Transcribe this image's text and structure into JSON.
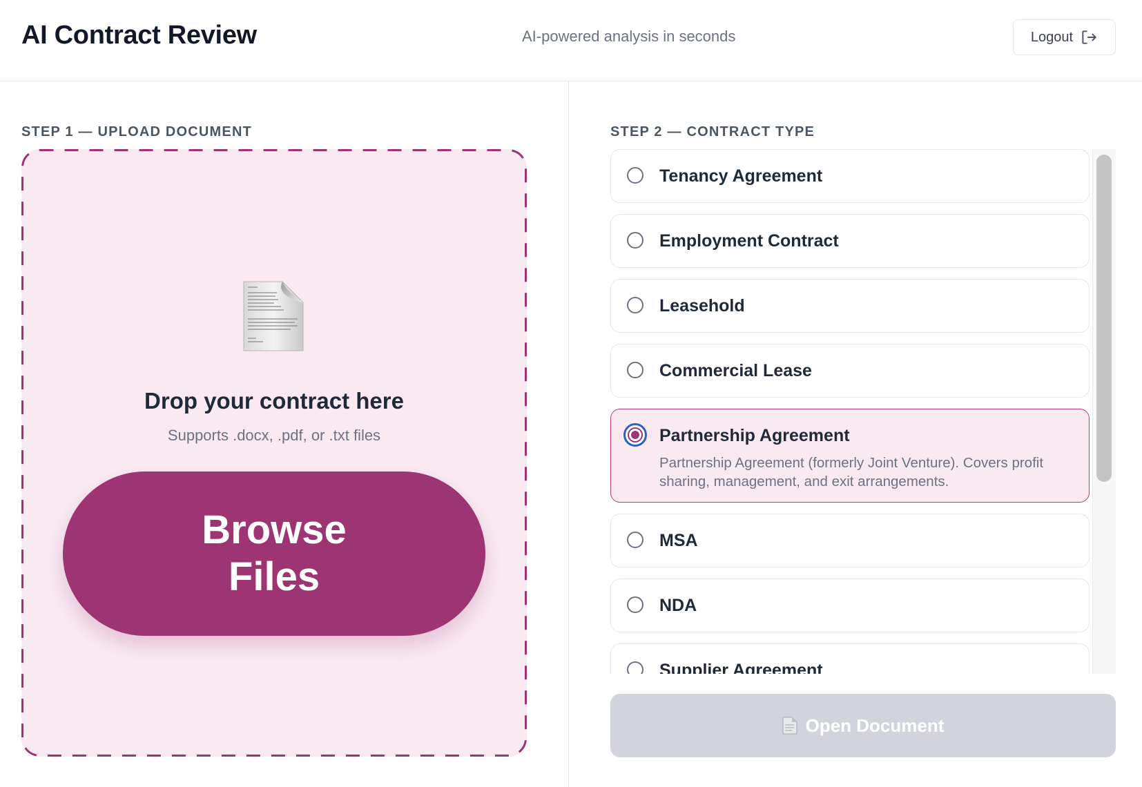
{
  "header": {
    "title": "AI Contract Review",
    "tagline": "AI-powered analysis in seconds",
    "logout_label": "Logout",
    "logout_icon": "logout-arrow-icon"
  },
  "upload": {
    "step_label": "STEP 1 — UPLOAD DOCUMENT",
    "icon": "document-icon",
    "title": "Drop your contract here",
    "subtitle": "Supports .docx, .pdf, or .txt files",
    "browse_label": "Browse Files"
  },
  "contract_types": {
    "step_label": "STEP 2 — CONTRACT TYPE",
    "selected": "Partnership Agreement",
    "options": [
      {
        "label": "Tenancy Agreement"
      },
      {
        "label": "Employment Contract"
      },
      {
        "label": "Leasehold"
      },
      {
        "label": "Commercial Lease"
      },
      {
        "label": "Partnership Agreement",
        "description": "Partnership Agreement (formerly Joint Venture). Covers profit sharing, management, and exit arrangements."
      },
      {
        "label": "MSA"
      },
      {
        "label": "NDA"
      },
      {
        "label": "Supplier Agreement"
      }
    ]
  },
  "actions": {
    "open_label": "Open Document",
    "open_icon": "document-icon",
    "open_disabled": true
  },
  "colors": {
    "brand": "#9e3573",
    "brand_tint": "#f9eaf2",
    "disabled": "#d1d5db"
  }
}
